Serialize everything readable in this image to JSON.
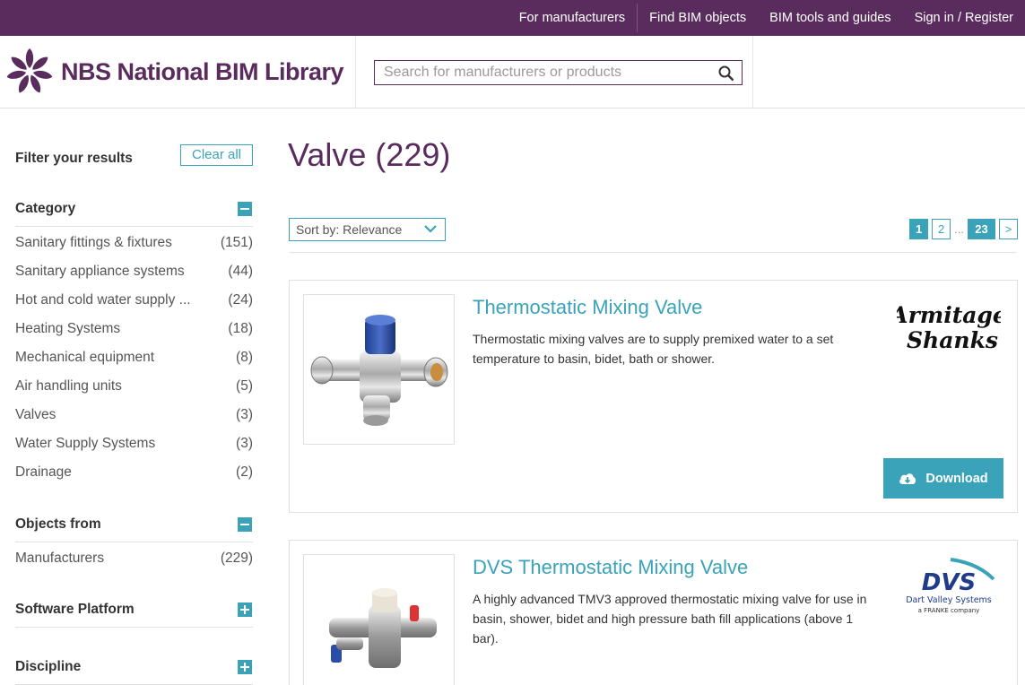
{
  "topnav": {
    "items": [
      "For manufacturers",
      "Find BIM objects",
      "BIM tools and guides",
      "Sign in / Register"
    ]
  },
  "header": {
    "logo_text": "NBS National BIM Library",
    "search_placeholder": "Search for manufacturers or products"
  },
  "sidebar": {
    "filter_heading": "Filter your results",
    "clear_all": "Clear all",
    "category": {
      "title": "Category",
      "items": [
        {
          "label": "Sanitary fittings & fixtures",
          "count": "(151)"
        },
        {
          "label": "Sanitary appliance systems",
          "count": "(44)"
        },
        {
          "label": "Hot and cold water supply ...",
          "count": "(24)"
        },
        {
          "label": "Heating Systems",
          "count": "(18)"
        },
        {
          "label": "Mechanical equipment",
          "count": "(8)"
        },
        {
          "label": "Air handling units",
          "count": "(5)"
        },
        {
          "label": "Valves",
          "count": "(3)"
        },
        {
          "label": "Water Supply Systems",
          "count": "(3)"
        },
        {
          "label": "Drainage",
          "count": "(2)"
        }
      ]
    },
    "objects_from": {
      "title": "Objects from",
      "items": [
        {
          "label": "Manufacturers",
          "count": "(229)"
        }
      ]
    },
    "software_platform": {
      "title": "Software Platform"
    },
    "discipline": {
      "title": "Discipline"
    }
  },
  "main": {
    "title": "Valve (229)",
    "sort_label": "Sort by: Relevance",
    "pagination": {
      "pages": [
        "1",
        "2",
        "23"
      ],
      "ellipsis": "...",
      "next": ">"
    },
    "results": [
      {
        "title": "Thermostatic Mixing Valve",
        "description": "Thermostatic mixing valves are to supply premixed water to a set temperature to basin, bidet, bath or shower.",
        "brand_line1": "Armitage",
        "brand_line2": "Shanks",
        "download_label": "Download"
      },
      {
        "title": "DVS Thermostatic Mixing Valve",
        "description": "A highly advanced TMV3 approved thermostatic mixing valve for use in basin, shower, bidet and high pressure bath fill applications (above 1 bar).",
        "brand_logo": "DVS",
        "brand_name": "Dart Valley Systems",
        "brand_sub": "a FRANKE company"
      }
    ]
  },
  "colors": {
    "brand_purple": "#5a2c5d",
    "accent_teal": "#3aa3b9"
  }
}
